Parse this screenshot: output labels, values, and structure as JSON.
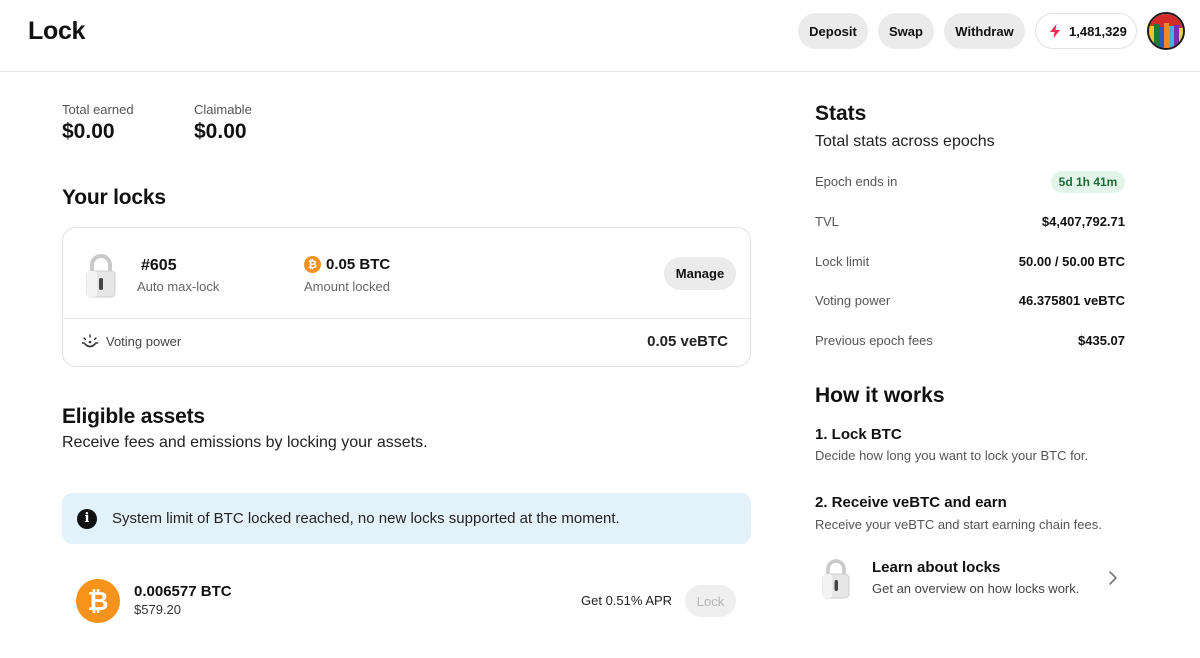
{
  "header": {
    "title": "Lock",
    "buttons": {
      "deposit": "Deposit",
      "swap": "Swap",
      "withdraw": "Withdraw"
    },
    "points": "1,481,329",
    "points_icon": "lightning-icon",
    "accent_color": "#e8294f"
  },
  "earnings": {
    "total_earned_label": "Total earned",
    "total_earned_value": "$0.00",
    "claimable_label": "Claimable",
    "claimable_value": "$0.00"
  },
  "your_locks": {
    "title": "Your locks",
    "lock": {
      "id": "#605",
      "type": "Auto max-lock",
      "amount": "0.05 BTC",
      "amount_label": "Amount locked",
      "manage_label": "Manage",
      "voting_power_label": "Voting power",
      "voting_power_value": "0.05 veBTC"
    }
  },
  "eligible_assets": {
    "title": "Eligible assets",
    "subtitle": "Receive fees and emissions by locking your assets.",
    "notice": "System limit of BTC locked reached, no new locks supported at the moment.",
    "asset": {
      "amount": "0.006577 BTC",
      "usd": "$579.20",
      "apr": "Get 0.51% APR",
      "lock_label": "Lock",
      "color": "#f7931a"
    }
  },
  "stats": {
    "title": "Stats",
    "subtitle": "Total stats across epochs",
    "rows": [
      {
        "label": "Epoch ends in",
        "value": "5d 1h 41m"
      },
      {
        "label": "TVL",
        "value": "$4,407,792.71"
      },
      {
        "label": "Lock limit",
        "value": "50.00 / 50.00 BTC"
      },
      {
        "label": "Voting power",
        "value": "46.375801 veBTC"
      },
      {
        "label": "Previous epoch fees",
        "value": "$435.07"
      }
    ]
  },
  "how_it_works": {
    "title": "How it works",
    "steps": [
      {
        "title": "1. Lock BTC",
        "desc": "Decide how long you want to lock your BTC for."
      },
      {
        "title": "2. Receive veBTC and earn",
        "desc": "Receive your veBTC and start earning chain fees."
      }
    ],
    "learn": {
      "title": "Learn about locks",
      "desc": "Get an overview on how locks work."
    }
  }
}
